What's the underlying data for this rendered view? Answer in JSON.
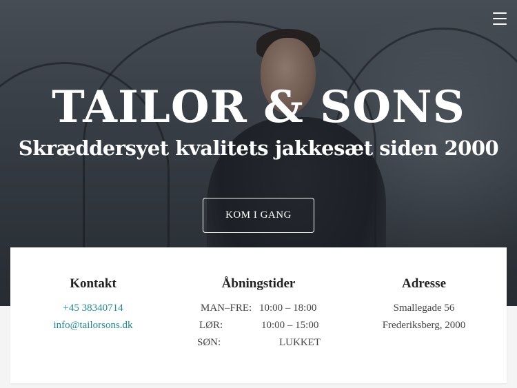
{
  "hero": {
    "title": "TAILOR & SONS",
    "subtitle": "Skræddersyet kvalitets jakkesæt siden 2000",
    "cta_label": "KOM I GANG"
  },
  "info": {
    "contact": {
      "heading": "Kontakt",
      "phone": "+45 38340714",
      "email": "info@tailorsons.dk"
    },
    "hours": {
      "heading": "Åbningstider",
      "rows": [
        {
          "day": "MAN–FRE:",
          "time": "10:00 – 18:00"
        },
        {
          "day": "LØR:",
          "time": "10:00 – 15:00"
        },
        {
          "day": "SØN:",
          "time": "LUKKET"
        }
      ]
    },
    "address": {
      "heading": "Adresse",
      "street": "Smallegade 56",
      "city": "Frederiksberg, 2000"
    }
  },
  "colors": {
    "link": "#1f8a95",
    "heading": "#222222",
    "body_text": "#444444"
  },
  "icons": {
    "menu": "hamburger-menu-icon"
  }
}
